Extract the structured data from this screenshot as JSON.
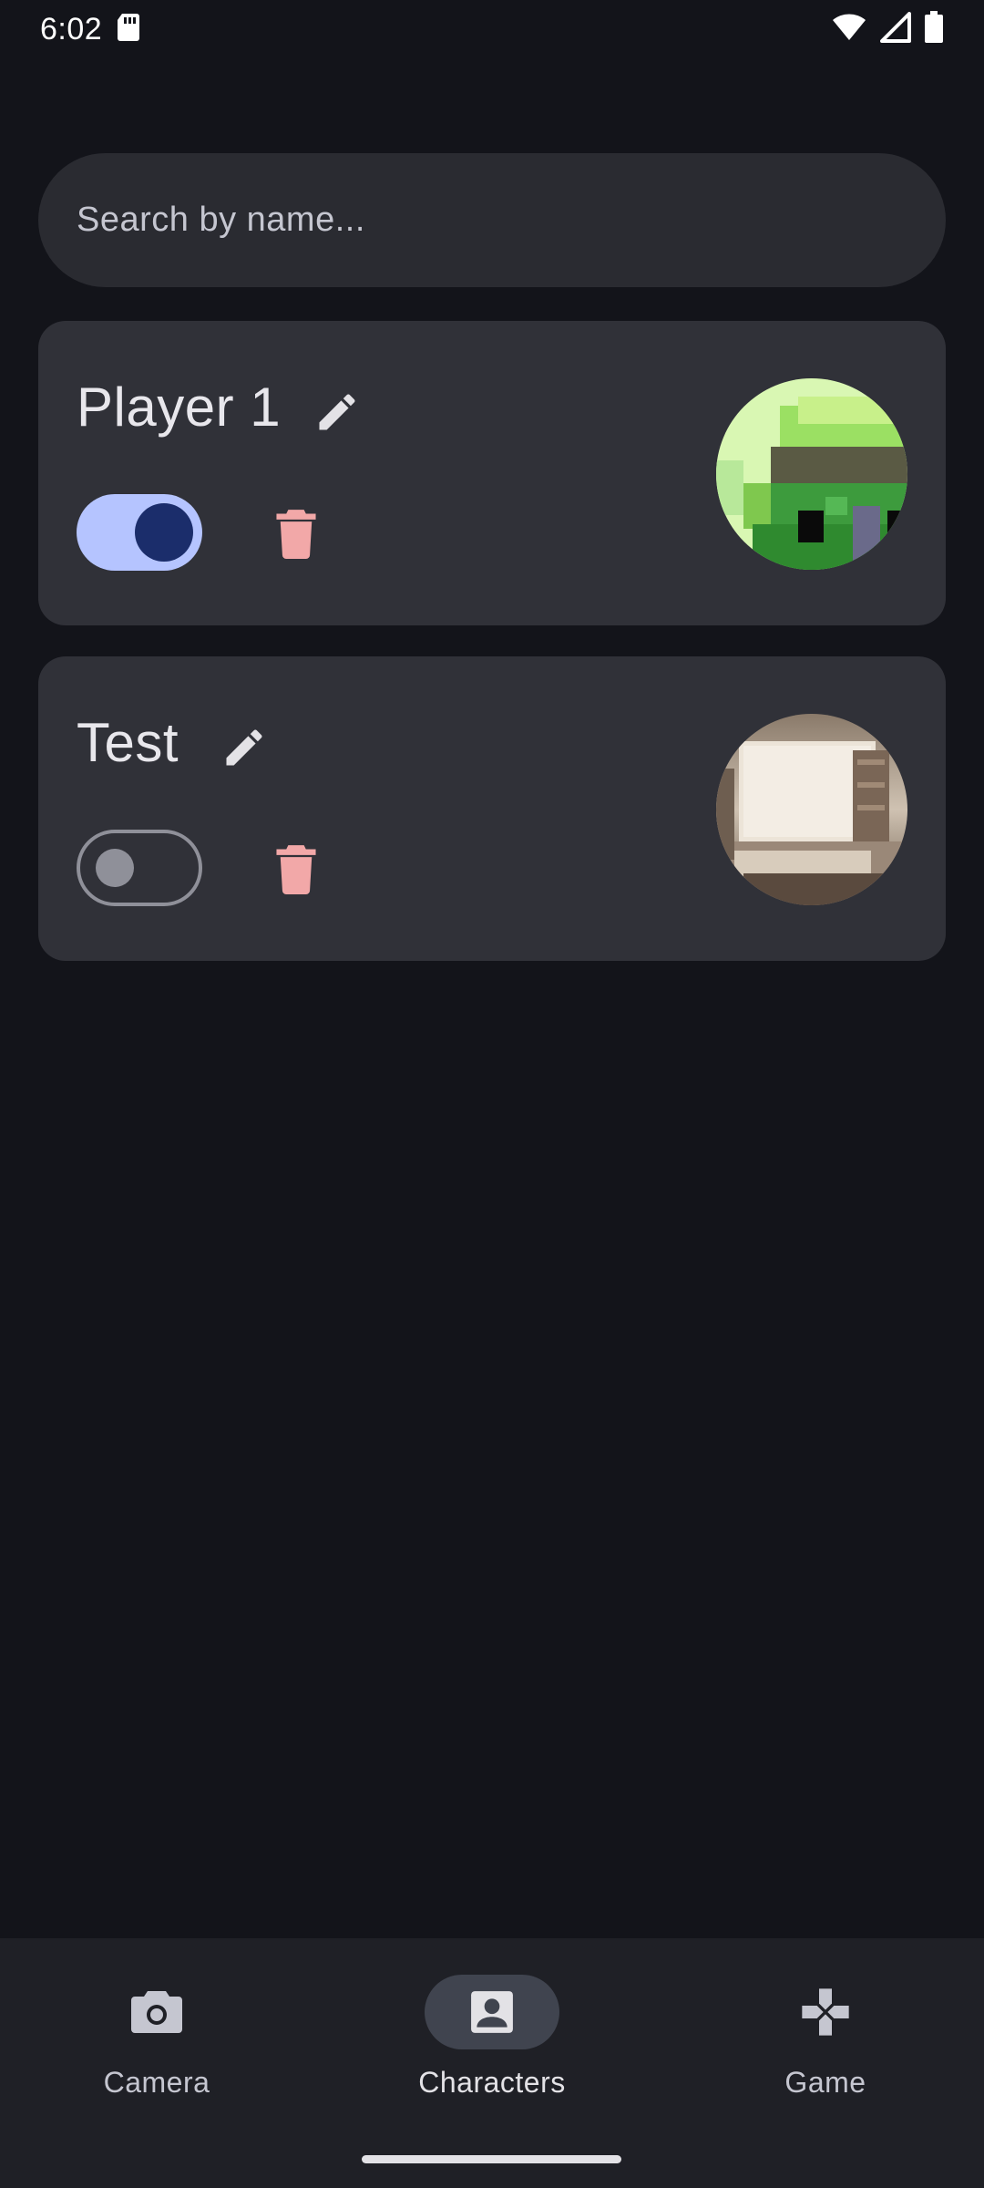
{
  "status_bar": {
    "time": "6:02",
    "icons": [
      "sd-card-icon",
      "wifi-icon",
      "signal-icon",
      "battery-icon"
    ]
  },
  "search": {
    "placeholder": "Search by name...",
    "value": ""
  },
  "characters": [
    {
      "name": "Player 1",
      "enabled": true,
      "avatar": "pixel-art-avatar"
    },
    {
      "name": "Test",
      "enabled": false,
      "avatar": "room-photo-avatar"
    }
  ],
  "bottom_nav": {
    "items": [
      {
        "label": "Camera",
        "icon": "camera-icon",
        "active": false
      },
      {
        "label": "Characters",
        "icon": "person-icon",
        "active": true
      },
      {
        "label": "Game",
        "icon": "gamepad-icon",
        "active": false
      }
    ]
  },
  "colors": {
    "background": "#13141a",
    "card": "#303138",
    "toggle_on": "#b5c4ff",
    "delete": "#f2a8a8"
  }
}
